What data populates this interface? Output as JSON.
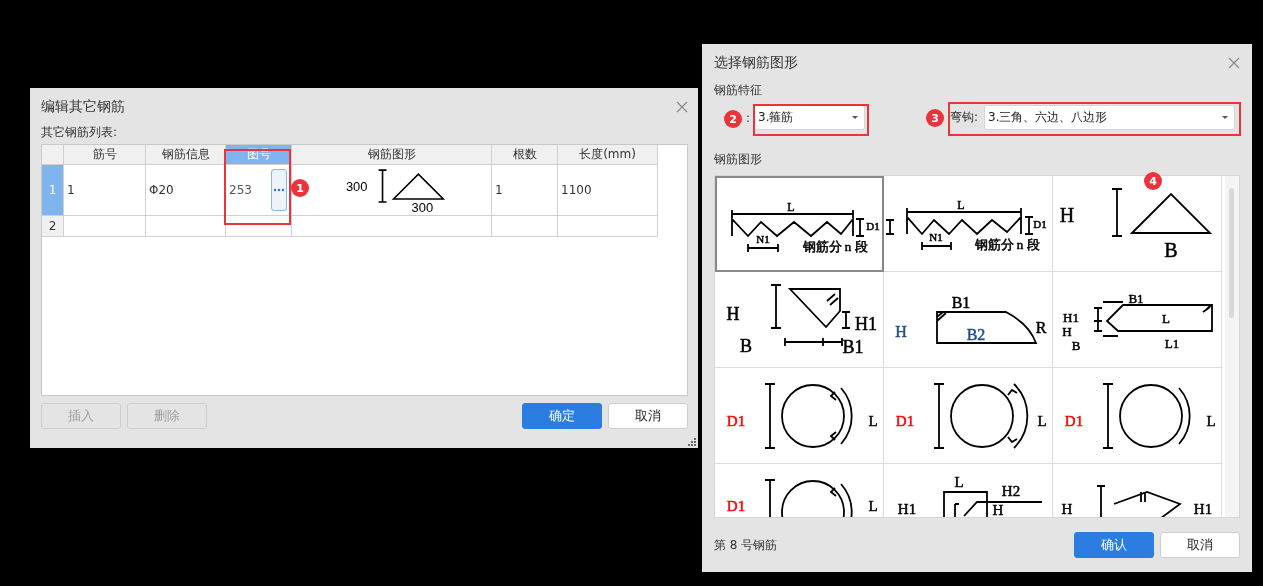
{
  "edit_dialog": {
    "title": "编辑其它钢筋",
    "list_label": "其它钢筋列表:",
    "columns": [
      {
        "label": "筋号",
        "selected": false
      },
      {
        "label": "钢筋信息",
        "selected": false
      },
      {
        "label": "图号",
        "selected": true
      },
      {
        "label": "钢筋图形",
        "selected": false
      },
      {
        "label": "根数",
        "selected": false
      },
      {
        "label": "长度(mm)",
        "selected": false
      }
    ],
    "rows": [
      {
        "number": "1",
        "selected": true,
        "bar_no": "1",
        "bar_info": "Φ20",
        "figure_no": "253",
        "shape_labels": [
          "300",
          "300"
        ],
        "count": "1",
        "length": "1100"
      },
      {
        "number": "2",
        "selected": false
      }
    ],
    "buttons": [
      {
        "label": "插入",
        "kind": "plain",
        "disabled": true
      },
      {
        "label": "删除",
        "kind": "plain",
        "disabled": true
      },
      {
        "label": "确定",
        "kind": "primary",
        "disabled": false
      },
      {
        "label": "取消",
        "kind": "plain",
        "disabled": false
      }
    ]
  },
  "shape_dialog": {
    "title": "选择钢筋图形",
    "features_label": "钢筋特征",
    "type_label": ":",
    "type_value": "3.箍筋",
    "hook_label": "弯钩:",
    "hook_value": "3.三角、六边、八边形",
    "shapes_label": "钢筋图形",
    "shapes": [
      {
        "kind": "zigzag",
        "selected": true,
        "labels": [
          {
            "text": "L"
          },
          {
            "text": "D1"
          },
          {
            "text": "N1"
          },
          {
            "text": "钢筋分 n 段"
          }
        ]
      },
      {
        "kind": "zigzag-ends",
        "selected": false,
        "labels": [
          {
            "text": "L"
          },
          {
            "text": "D1"
          },
          {
            "text": "N1"
          },
          {
            "text": "钢筋分 n 段"
          }
        ]
      },
      {
        "kind": "triangle",
        "selected": false,
        "labels": [
          {
            "text": "H"
          },
          {
            "text": "B"
          }
        ]
      },
      {
        "kind": "corner",
        "selected": false,
        "labels": [
          {
            "text": "H"
          },
          {
            "text": "B"
          },
          {
            "text": "H1"
          },
          {
            "text": "B1"
          }
        ]
      },
      {
        "kind": "slab",
        "selected": false,
        "labels": [
          {
            "text": "B1"
          },
          {
            "text": "H",
            "color": "#1f4e8c"
          },
          {
            "text": "B2",
            "color": "#1f4e8c"
          },
          {
            "text": "R"
          }
        ]
      },
      {
        "kind": "pointed",
        "selected": false,
        "labels": [
          {
            "text": "B1"
          },
          {
            "text": "H1"
          },
          {
            "text": "H"
          },
          {
            "text": "B"
          },
          {
            "text": "L"
          },
          {
            "text": "L1"
          }
        ]
      },
      {
        "kind": "circle-hooks-in",
        "selected": false,
        "labels": [
          {
            "text": "D1",
            "color": "#ff0000"
          },
          {
            "text": "L"
          }
        ]
      },
      {
        "kind": "circle-hooks-out",
        "selected": false,
        "labels": [
          {
            "text": "D1",
            "color": "#ff0000"
          },
          {
            "text": "L"
          }
        ]
      },
      {
        "kind": "circle",
        "selected": false,
        "labels": [
          {
            "text": "D1",
            "color": "#ff0000"
          },
          {
            "text": "L"
          }
        ]
      },
      {
        "kind": "circle-partial",
        "selected": false,
        "labels": [
          {
            "text": "D1",
            "color": "#ff0000"
          },
          {
            "text": "L"
          }
        ]
      },
      {
        "kind": "frame",
        "selected": false,
        "labels": [
          {
            "text": "L"
          },
          {
            "text": "H2"
          },
          {
            "text": "H1"
          },
          {
            "text": "H"
          }
        ]
      },
      {
        "kind": "hexagon",
        "selected": false,
        "labels": [
          {
            "text": "H"
          },
          {
            "text": "H1"
          }
        ]
      }
    ],
    "status": "第 8 号钢筋",
    "buttons": [
      {
        "label": "确认",
        "kind": "primary",
        "disabled": false
      },
      {
        "label": "取消",
        "kind": "plain",
        "disabled": false
      }
    ]
  },
  "annotations": [
    {
      "number": "1"
    },
    {
      "number": "2"
    },
    {
      "number": "3"
    },
    {
      "number": "4"
    }
  ]
}
